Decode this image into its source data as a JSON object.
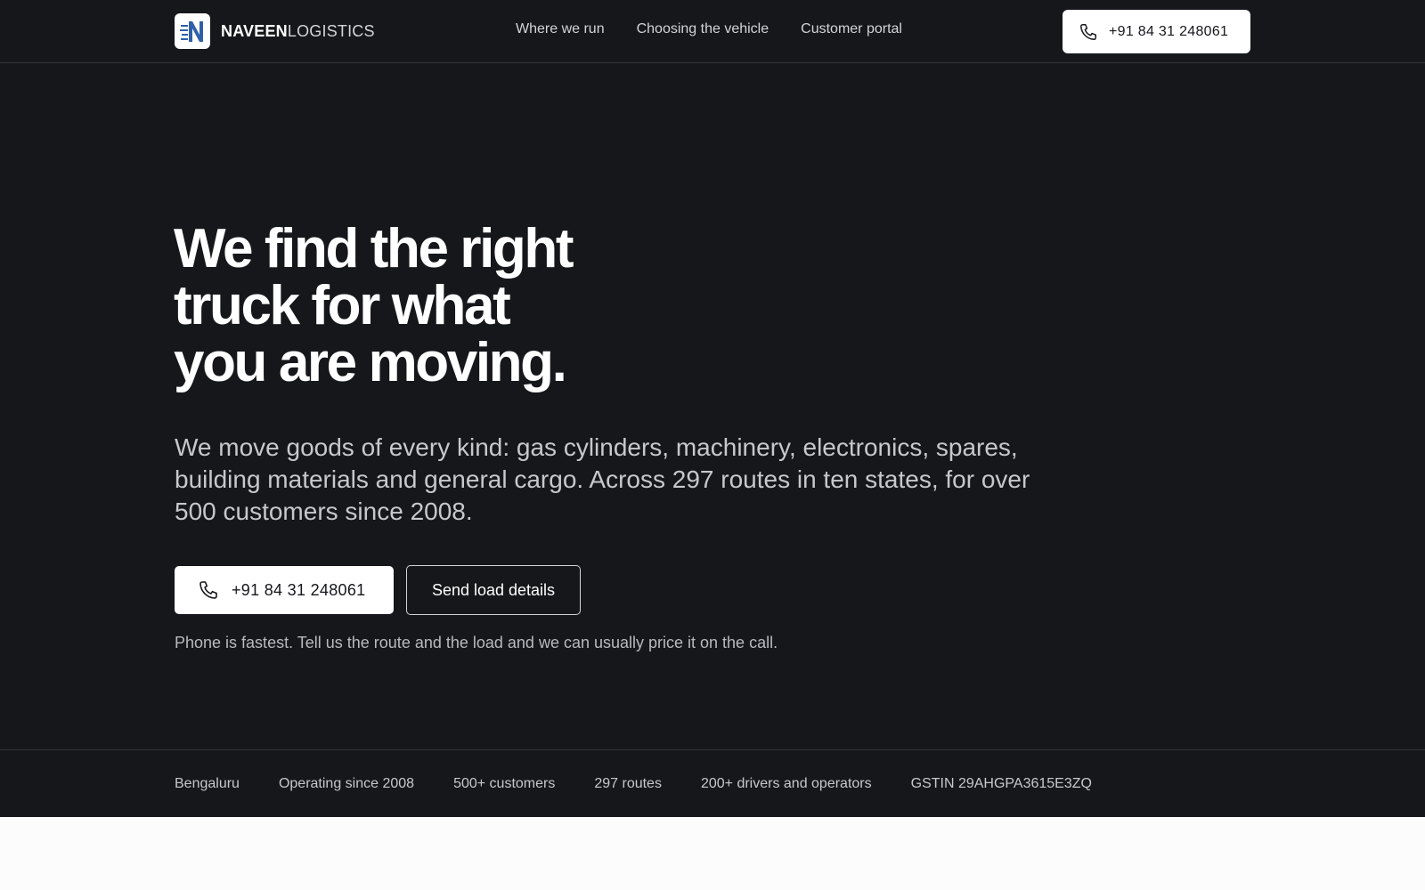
{
  "header": {
    "brand_bold": "NAVEEN",
    "brand_light": "LOGISTICS",
    "nav": [
      {
        "label": "Where we run"
      },
      {
        "label": "Choosing the vehicle"
      },
      {
        "label": "Customer portal"
      }
    ],
    "phone_label": "+91 84 31 248061"
  },
  "hero": {
    "title": "We find the right\ntruck for what\nyou are moving.",
    "description": "We move goods of every kind: gas cylinders, machinery, electronics, spares, building materials and general cargo. Across 297 routes in ten states, for over 500 customers since 2008.",
    "primary_cta": "+91 84 31 248061",
    "secondary_cta": "Send load details",
    "note": "Phone is fastest. Tell us the route and the load and we can usually price it on the call."
  },
  "strip": {
    "items": [
      "Bengaluru",
      "Operating since 2008",
      "500+ customers",
      "297 routes",
      "200+ drivers and operators",
      "GSTIN 29AHGPA3615E3ZQ"
    ]
  },
  "icons": {
    "phone": "phone-icon",
    "logo": "logo-n-icon"
  },
  "colors": {
    "background": "#16171b",
    "accent": "#2f5fa8",
    "light_bg": "#fcfcfc"
  }
}
